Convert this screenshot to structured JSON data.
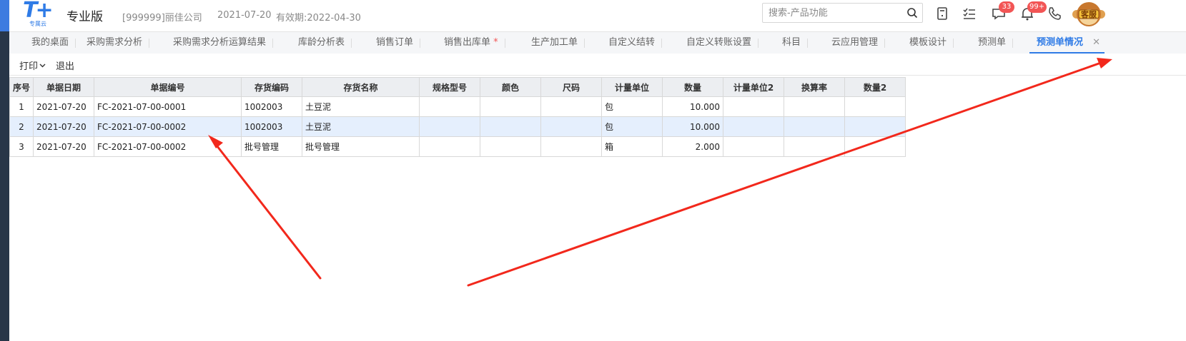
{
  "header": {
    "logo_text": "T+",
    "logo_sub": "专属云",
    "edition": "专业版",
    "company": "[999999]丽佳公司",
    "date": "2021-07-20",
    "valid_until": "有效期:2022-04-30",
    "search_placeholder": "搜索-产品功能",
    "badges": {
      "messages": "33",
      "notifications": "99+"
    },
    "avatar_text": "客服"
  },
  "tabs": [
    {
      "label": "我的桌面"
    },
    {
      "label": "采购需求分析"
    },
    {
      "label": "采购需求分析运算结果"
    },
    {
      "label": "库龄分析表"
    },
    {
      "label": "销售订单"
    },
    {
      "label": "销售出库单",
      "star": "*"
    },
    {
      "label": "生产加工单"
    },
    {
      "label": "自定义结转"
    },
    {
      "label": "自定义转账设置"
    },
    {
      "label": "科目"
    },
    {
      "label": "云应用管理"
    },
    {
      "label": "模板设计"
    },
    {
      "label": "预测单"
    },
    {
      "label": "预测单情况",
      "active": true
    }
  ],
  "toolbar": {
    "print": "打印",
    "exit": "退出"
  },
  "table": {
    "columns": [
      "序号",
      "单据日期",
      "单据编号",
      "存货编码",
      "存货名称",
      "规格型号",
      "颜色",
      "尺码",
      "计量单位",
      "数量",
      "计量单位2",
      "换算率",
      "数量2"
    ],
    "rows": [
      [
        "1",
        "2021-07-20",
        "FC-2021-07-00-0001",
        "1002003",
        "土豆泥",
        "",
        "",
        "",
        "包",
        "10.000",
        "",
        "",
        ""
      ],
      [
        "2",
        "2021-07-20",
        "FC-2021-07-00-0002",
        "1002003",
        "土豆泥",
        "",
        "",
        "",
        "包",
        "10.000",
        "",
        "",
        ""
      ],
      [
        "3",
        "2021-07-20",
        "FC-2021-07-00-0002",
        "批号管理",
        "批号管理",
        "",
        "",
        "",
        "箱",
        "2.000",
        "",
        "",
        ""
      ]
    ],
    "selected_row": 1
  },
  "colors": {
    "accent": "#2f7be6",
    "annotation_arrow": "#f2281c",
    "selected_row": "#e5effd"
  }
}
